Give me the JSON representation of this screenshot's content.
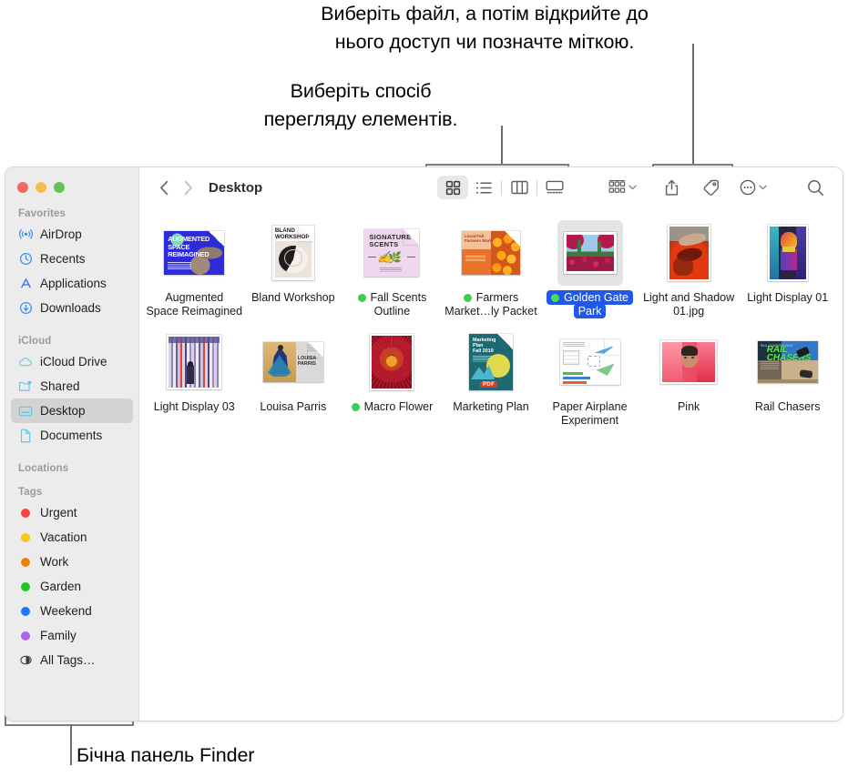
{
  "callouts": {
    "top": "Виберіть файл, а потім відкрийте до\nнього доступ чи позначте міткою.",
    "view": "Виберіть спосіб\nперегляду елементів.",
    "sidebar": "Бічна панель Finder"
  },
  "window": {
    "traffic_lights": [
      {
        "name": "close",
        "color": "#ec6a5f"
      },
      {
        "name": "minimize",
        "color": "#f4bd4f"
      },
      {
        "name": "zoom",
        "color": "#61c454"
      }
    ]
  },
  "sidebar": {
    "groups": [
      {
        "title": "Favorites",
        "items": [
          {
            "label": "AirDrop",
            "icon": "airdrop-icon",
            "selected": false
          },
          {
            "label": "Recents",
            "icon": "clock-icon",
            "selected": false
          },
          {
            "label": "Applications",
            "icon": "applications-icon",
            "selected": false
          },
          {
            "label": "Downloads",
            "icon": "download-icon",
            "selected": false
          }
        ]
      },
      {
        "title": "iCloud",
        "items": [
          {
            "label": "iCloud Drive",
            "icon": "cloud-icon",
            "selected": false
          },
          {
            "label": "Shared",
            "icon": "shared-folder-icon",
            "selected": false
          },
          {
            "label": "Desktop",
            "icon": "desktop-icon",
            "selected": true
          },
          {
            "label": "Documents",
            "icon": "document-icon",
            "selected": false
          }
        ]
      },
      {
        "title": "Locations",
        "items": []
      },
      {
        "title": "Tags",
        "items": [
          {
            "label": "Urgent",
            "icon": "tag-dot",
            "color": "#f8453f",
            "selected": false
          },
          {
            "label": "Vacation",
            "icon": "tag-dot",
            "color": "#fcc417",
            "selected": false
          },
          {
            "label": "Work",
            "icon": "tag-dot",
            "color": "#f08000",
            "selected": false
          },
          {
            "label": "Garden",
            "icon": "tag-dot",
            "color": "#20c627",
            "selected": false
          },
          {
            "label": "Weekend",
            "icon": "tag-dot",
            "color": "#1a7aff",
            "selected": false
          },
          {
            "label": "Family",
            "icon": "tag-dot",
            "color": "#b262e8",
            "selected": false
          },
          {
            "label": "All Tags…",
            "icon": "all-tags-icon",
            "color": "",
            "selected": false
          }
        ]
      }
    ]
  },
  "toolbar": {
    "back_label": "‹",
    "forward_label": "›",
    "path_title": "Desktop",
    "view_modes": [
      {
        "name": "icon-view",
        "active": true
      },
      {
        "name": "list-view",
        "active": false
      },
      {
        "name": "column-view",
        "active": false
      },
      {
        "name": "gallery-view",
        "active": false
      }
    ],
    "group_button": "group-items-icon",
    "share_button": "share-icon",
    "tag_button": "tag-icon",
    "more_button": "more-actions-icon",
    "search_button": "search-icon"
  },
  "files": [
    {
      "name": "Augmented\nSpace Reimagined",
      "tag": null,
      "selected": false,
      "kind": "doc",
      "thumb": "augmented-space"
    },
    {
      "name": "Bland Workshop",
      "tag": null,
      "selected": false,
      "kind": "doc",
      "thumb": "bland-workshop"
    },
    {
      "name": "Fall Scents\nOutline",
      "tag": "#3bcd4b",
      "selected": false,
      "kind": "doc",
      "thumb": "fall-scents"
    },
    {
      "name": "Farmers\nMarket…ly Packet",
      "tag": "#3bcd4b",
      "selected": false,
      "kind": "doc",
      "thumb": "farmers-market"
    },
    {
      "name": "Golden Gate\nPark",
      "tag": "#3bcd4b",
      "selected": true,
      "kind": "photo",
      "thumb": "golden-gate-park"
    },
    {
      "name": "Light and Shadow\n01.jpg",
      "tag": null,
      "selected": false,
      "kind": "photo",
      "thumb": "light-shadow"
    },
    {
      "name": "Light Display 01",
      "tag": null,
      "selected": false,
      "kind": "photo",
      "thumb": "light-display-01"
    },
    {
      "name": "Light Display 03",
      "tag": null,
      "selected": false,
      "kind": "photo",
      "thumb": "light-display-03"
    },
    {
      "name": "Louisa Parris",
      "tag": null,
      "selected": false,
      "kind": "doc",
      "thumb": "louisa-parris"
    },
    {
      "name": "Macro Flower",
      "tag": "#3bcd4b",
      "selected": false,
      "kind": "photo",
      "thumb": "macro-flower"
    },
    {
      "name": "Marketing Plan",
      "tag": null,
      "selected": false,
      "kind": "doc",
      "thumb": "marketing-plan"
    },
    {
      "name": "Paper Airplane\nExperiment",
      "tag": null,
      "selected": false,
      "kind": "doc",
      "thumb": "paper-airplane"
    },
    {
      "name": "Pink",
      "tag": null,
      "selected": false,
      "kind": "photo",
      "thumb": "pink"
    },
    {
      "name": "Rail Chasers",
      "tag": null,
      "selected": false,
      "kind": "photo",
      "thumb": "rail-chasers"
    }
  ]
}
